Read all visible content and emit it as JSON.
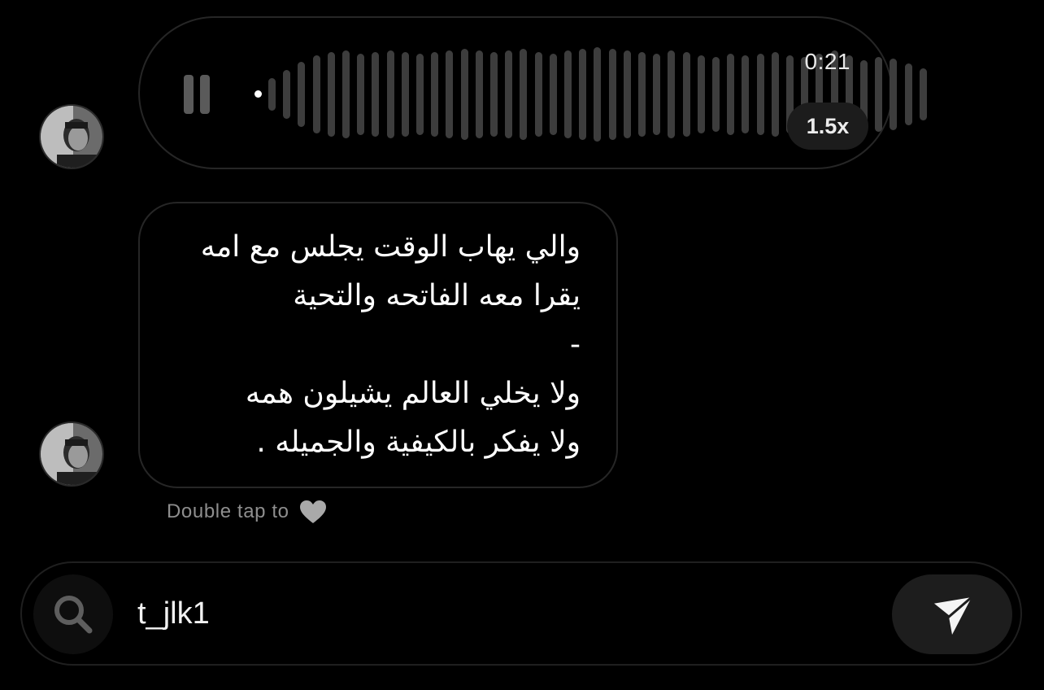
{
  "voice_message": {
    "duration": "0:21",
    "playback_speed": "1.5x",
    "state": "playing",
    "progress": 0.0,
    "icons": {
      "control": "pause-icon"
    }
  },
  "text_message": {
    "body": "والي يهاب الوقت يجلس مع امه\nيقرا معه الفاتحه والتحية\n-\nولا يخلي العالم يشيلون همه\nولا يفكر بالكيفية والجميله ."
  },
  "hint": {
    "label": "Double tap to",
    "icon": "heart-icon"
  },
  "composer": {
    "value": "t_jlk1",
    "left_icon": "search-icon",
    "right_icon": "send-icon"
  },
  "colors": {
    "background": "#000000",
    "bubble_border": "#262626",
    "waveform": "#3d3d3d",
    "hint_text": "#8e8e8e",
    "pill_background": "#1c1c1c"
  }
}
